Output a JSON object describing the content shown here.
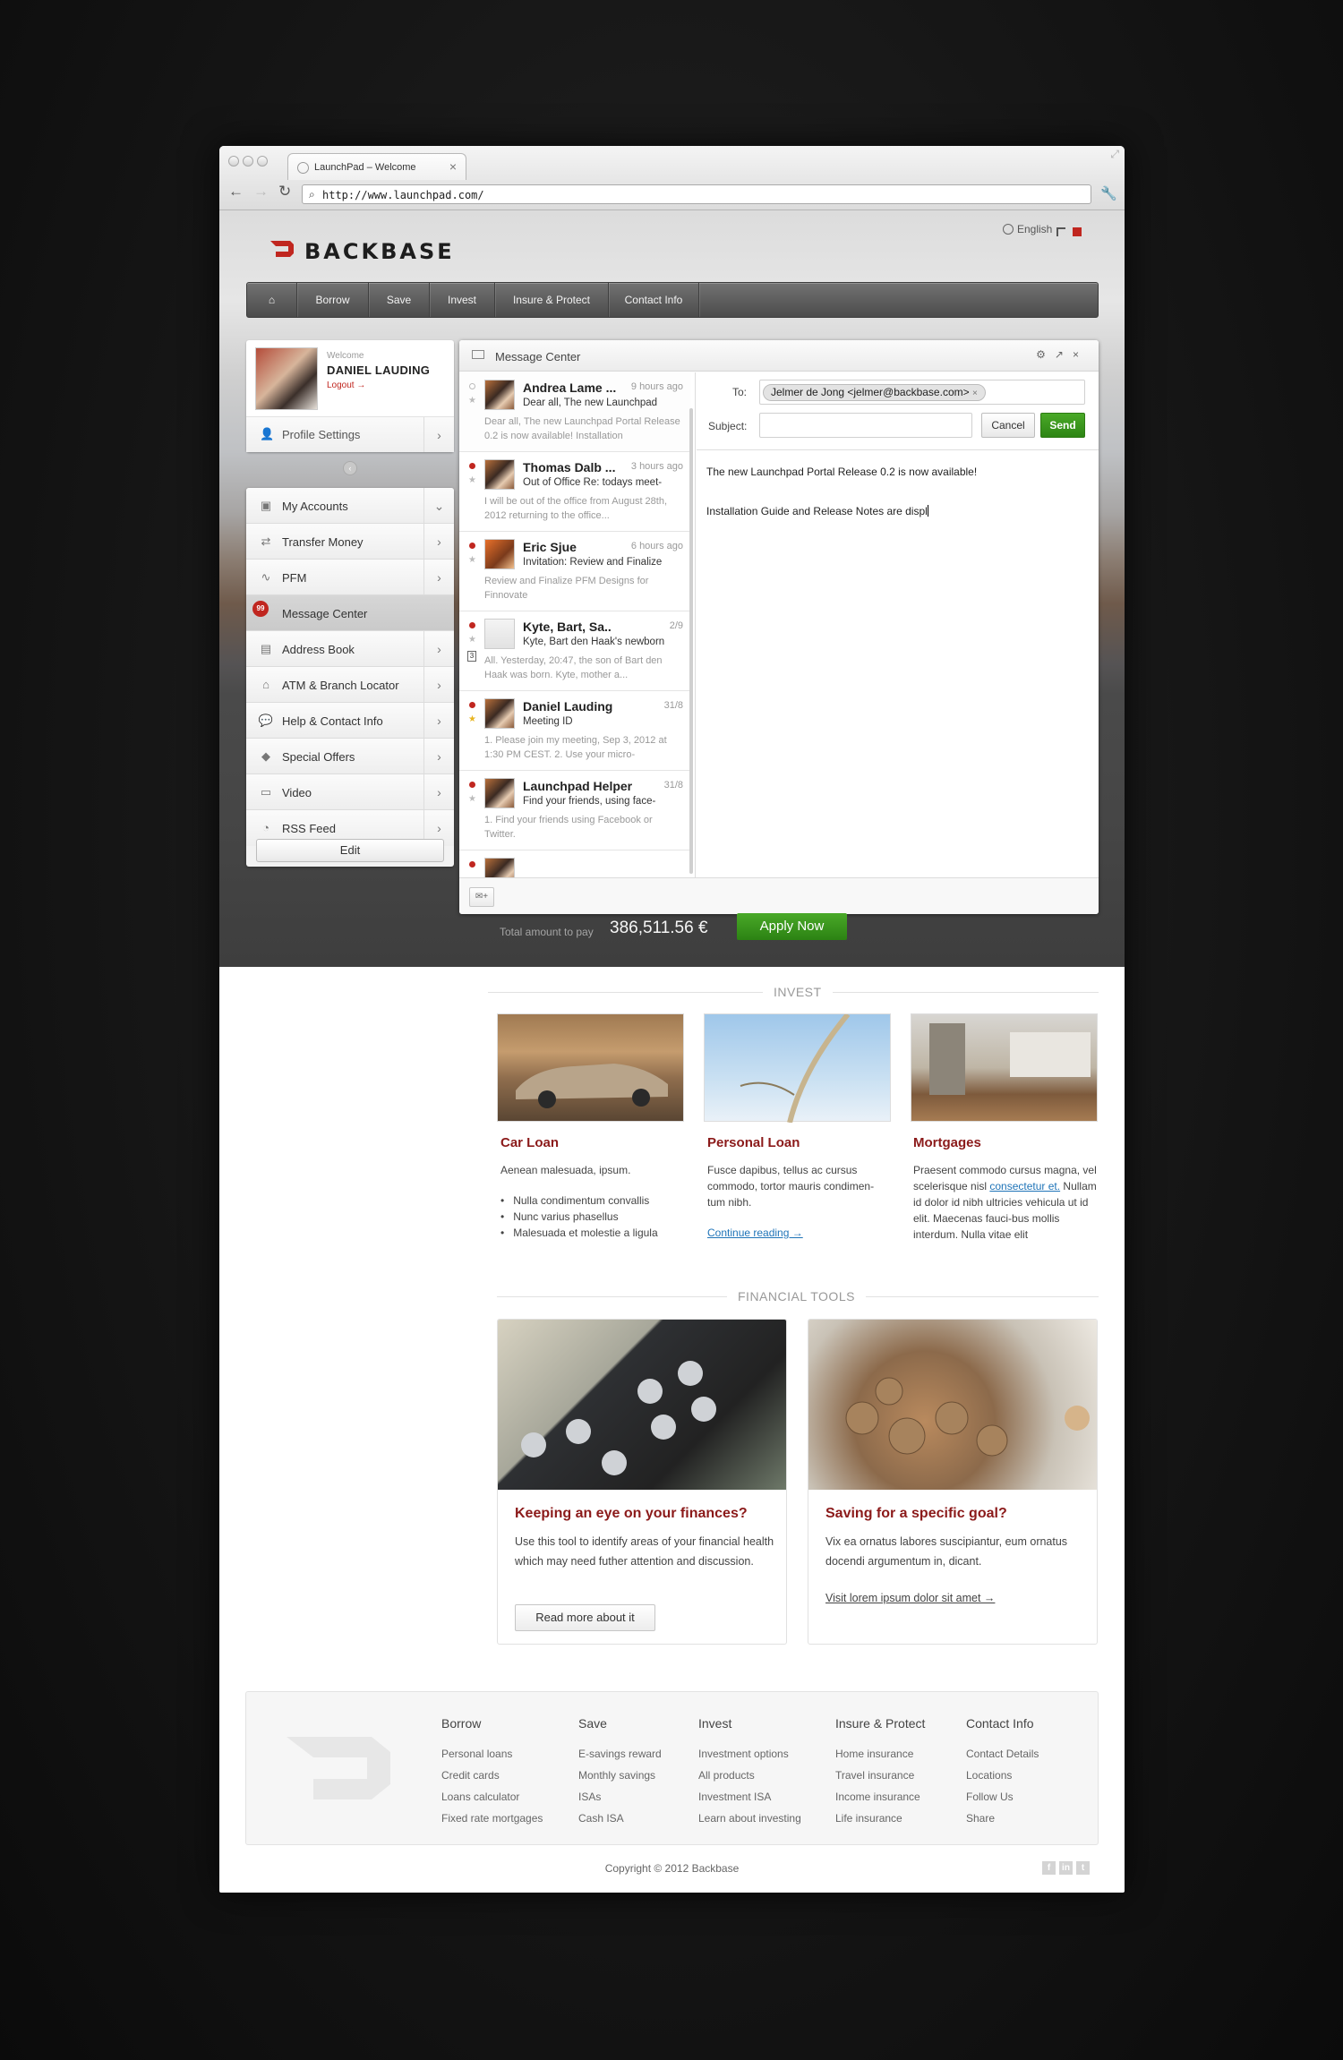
{
  "browser": {
    "tab_title": "LaunchPad – Welcome",
    "url": "http://www.launchpad.com/"
  },
  "brand": {
    "name": "BACKBASE",
    "accent_color": "#c0261f"
  },
  "language": {
    "label": "English"
  },
  "nav": {
    "items": [
      "Borrow",
      "Save",
      "Invest",
      "Insure & Protect",
      "Contact Info"
    ]
  },
  "profile": {
    "welcome": "Welcome",
    "name": "DANIEL LAUDING",
    "logout": "Logout →",
    "settings": "Profile Settings"
  },
  "menu": {
    "items": [
      {
        "label": "My Accounts",
        "icon": "briefcase-icon",
        "chevron": "chevron-down-icon"
      },
      {
        "label": "Transfer Money",
        "icon": "transfer-icon",
        "chevron": "chevron-right-icon"
      },
      {
        "label": "PFM",
        "icon": "chart-icon",
        "chevron": "chevron-right-icon"
      },
      {
        "label": "Message Center",
        "icon": "mail-badge-icon",
        "badge": "99"
      },
      {
        "label": "Address Book",
        "icon": "address-book-icon",
        "chevron": "chevron-right-icon"
      },
      {
        "label": "ATM & Branch Locator",
        "icon": "bank-icon",
        "chevron": "chevron-right-icon"
      },
      {
        "label": "Help & Contact Info",
        "icon": "chat-icon",
        "chevron": "chevron-right-icon"
      },
      {
        "label": "Special Offers",
        "icon": "tag-icon",
        "chevron": "chevron-right-icon"
      },
      {
        "label": "Video",
        "icon": "tv-icon",
        "chevron": "chevron-right-icon"
      },
      {
        "label": "RSS Feed",
        "icon": "rss-icon",
        "chevron": "chevron-right-icon"
      }
    ],
    "edit": "Edit"
  },
  "message_center": {
    "title": "Message Center",
    "messages": [
      {
        "sender": "Andrea Lame ...",
        "time": "9 hours ago",
        "subject": "Dear all, The new Launchpad",
        "snippet": "Dear all, The new Launchpad Portal Release 0.2 is now available! Installation",
        "unread": false,
        "starred": false
      },
      {
        "sender": "Thomas Dalb ...",
        "time": "3 hours ago",
        "subject": "Out of Office Re: todays meet-",
        "snippet": "I will be out of the office from August 28th, 2012 returning to the office...",
        "unread": true,
        "starred": false
      },
      {
        "sender": "Eric Sjue",
        "time": "6 hours ago",
        "subject": "Invitation: Review and Finalize",
        "snippet": "Review and Finalize PFM Designs for Finnovate",
        "unread": true,
        "starred": false
      },
      {
        "sender": "Kyte, Bart, Sa..",
        "time": "2/9",
        "subject": "Kyte, Bart den Haak's newborn",
        "snippet": "All. Yesterday, 20:47, the son of Bart den Haak was born. Kyte, mother a...",
        "unread": true,
        "starred": false,
        "attachment": "3"
      },
      {
        "sender": "Daniel Lauding",
        "time": "31/8",
        "subject": "Meeting ID",
        "snippet": "1.  Please join my meeting, Sep 3, 2012 at 1:30 PM CEST. 2.  Use your micro-",
        "unread": true,
        "starred": true
      },
      {
        "sender": "Launchpad Helper",
        "time": "31/8",
        "subject": "Find your friends, using face-",
        "snippet": "1. Find your friends using Facebook or Twitter.",
        "unread": true,
        "starred": false
      }
    ],
    "compose": {
      "to_label": "To:",
      "to_recipient": "Jelmer de Jong <jelmer@backbase.com>",
      "subject_label": "Subject:",
      "subject_value": "",
      "cancel": "Cancel",
      "send": "Send",
      "body_line1": "The new Launchpad Portal Release 0.2 is now available!",
      "body_line2": "Installation Guide and Release Notes are displ"
    }
  },
  "total": {
    "label": "Total amount to pay",
    "value": "386,511.56 €",
    "apply": "Apply Now"
  },
  "invest": {
    "section_title": "INVEST",
    "cards": [
      {
        "title": "Car Loan",
        "text": "Aenean malesuada, ipsum.",
        "bullets": [
          "Nulla condimentum convallis",
          "Nunc varius phasellus",
          "Malesuada et molestie a ligula"
        ]
      },
      {
        "title": "Personal Loan",
        "text": "Fusce dapibus, tellus ac cursus commodo, tortor mauris condimen-tum nibh.",
        "link": "Continue reading →"
      },
      {
        "title": "Mortgages",
        "text_before_link": "Praesent commodo cursus magna, vel scelerisque nisl ",
        "link": "consectetur et.",
        "text_after_link": " Nullam id dolor id nibh ultricies vehicula ut id elit. Maecenas fauci-bus mollis interdum. Nulla vitae elit"
      }
    ]
  },
  "tools": {
    "section_title": "FINANCIAL TOOLS",
    "cards": [
      {
        "title": "Keeping an eye on your finances?",
        "text": "Use this tool to identify areas of your financial health which may need futher attention and discussion.",
        "button": "Read more about it"
      },
      {
        "title": "Saving for a specific goal?",
        "text": "Vix ea ornatus labores suscipiantur, eum ornatus docendi argumentum in, dicant.",
        "link": "Visit lorem ipsum dolor sit amet →"
      }
    ]
  },
  "footer": {
    "columns": [
      {
        "title": "Borrow",
        "links": [
          "Personal loans",
          "Credit cards",
          "Loans calculator",
          "Fixed rate mortgages"
        ]
      },
      {
        "title": "Save",
        "links": [
          "E-savings reward",
          "Monthly savings",
          "ISAs",
          "Cash ISA"
        ]
      },
      {
        "title": "Invest",
        "links": [
          "Investment options",
          "All products",
          "Investment ISA",
          "Learn about investing"
        ]
      },
      {
        "title": "Insure & Protect",
        "links": [
          "Home insurance",
          "Travel insurance",
          "Income insurance",
          "Life insurance"
        ]
      },
      {
        "title": "Contact Info",
        "links": [
          "Contact Details",
          "Locations",
          "Follow Us",
          "Share"
        ]
      }
    ],
    "copyright": "Copyright © 2012 Backbase",
    "social": [
      "facebook-icon",
      "linkedin-icon",
      "twitter-icon"
    ]
  }
}
